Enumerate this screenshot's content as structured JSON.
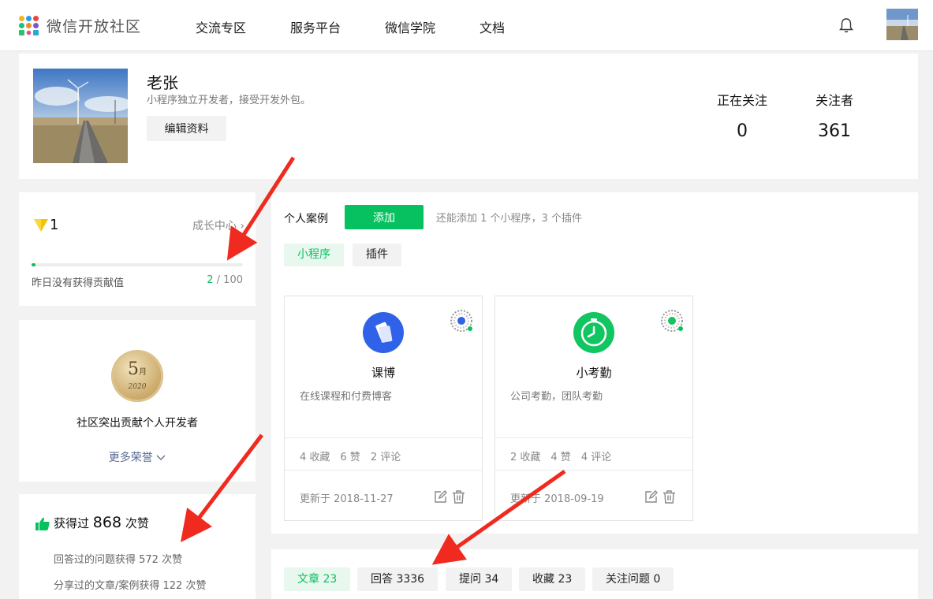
{
  "header": {
    "site_title": "微信开放社区",
    "nav": [
      "交流专区",
      "服务平台",
      "微信学院",
      "文档"
    ],
    "logo_colors": [
      "#f0b624",
      "#2b9bf0",
      "#e9463d",
      "#16c08b",
      "#f08c2b",
      "#7a56d6",
      "#2ec06a",
      "#e94a8b",
      "#2aa8d6"
    ]
  },
  "profile": {
    "name": "老张",
    "bio": "小程序独立开发者，接受开发外包。",
    "edit_label": "编辑资料",
    "following_label": "正在关注",
    "following_count": "0",
    "followers_label": "关注者",
    "followers_count": "361"
  },
  "growth": {
    "level": "1",
    "center_link": "成长中心 ›",
    "note": "昨日没有获得贡献值",
    "progress_current": "2",
    "progress_total": " / 100",
    "progress_fraction": 0.02
  },
  "honor": {
    "medal_month": "5",
    "medal_unit": "月",
    "medal_year": "2020",
    "title": "社区突出贡献个人开发者",
    "more_label": "更多荣誉"
  },
  "likes": {
    "prefix": "获得过",
    "count": "868",
    "suffix": "次赞",
    "answers_line": "回答过的问题获得 572 次赞",
    "shares_line": "分享过的文章/案例获得 122 次赞"
  },
  "cases": {
    "title": "个人案例",
    "add_label": "添加",
    "hint": "还能添加 1 个小程序，3 个插件",
    "subtabs": [
      "小程序",
      "插件"
    ],
    "apps": [
      {
        "name": "课博",
        "desc": "在线课程和付费博客",
        "fav": "4 收藏",
        "likes": "6 赞",
        "comments": "2 评论",
        "updated": "更新于 2018-11-27",
        "color": "#2f62e8"
      },
      {
        "name": "小考勤",
        "desc": "公司考勤，团队考勤",
        "fav": "2 收藏",
        "likes": "4 赞",
        "comments": "4 评论",
        "updated": "更新于 2018-09-19",
        "color": "#11c560"
      }
    ]
  },
  "content_tabs": [
    "文章 23",
    "回答 3336",
    "提问 34",
    "收藏 23",
    "关注问题 0"
  ],
  "colors": {
    "accent": "#07c160",
    "link": "#576b95",
    "arrow": "#f02a1e"
  }
}
